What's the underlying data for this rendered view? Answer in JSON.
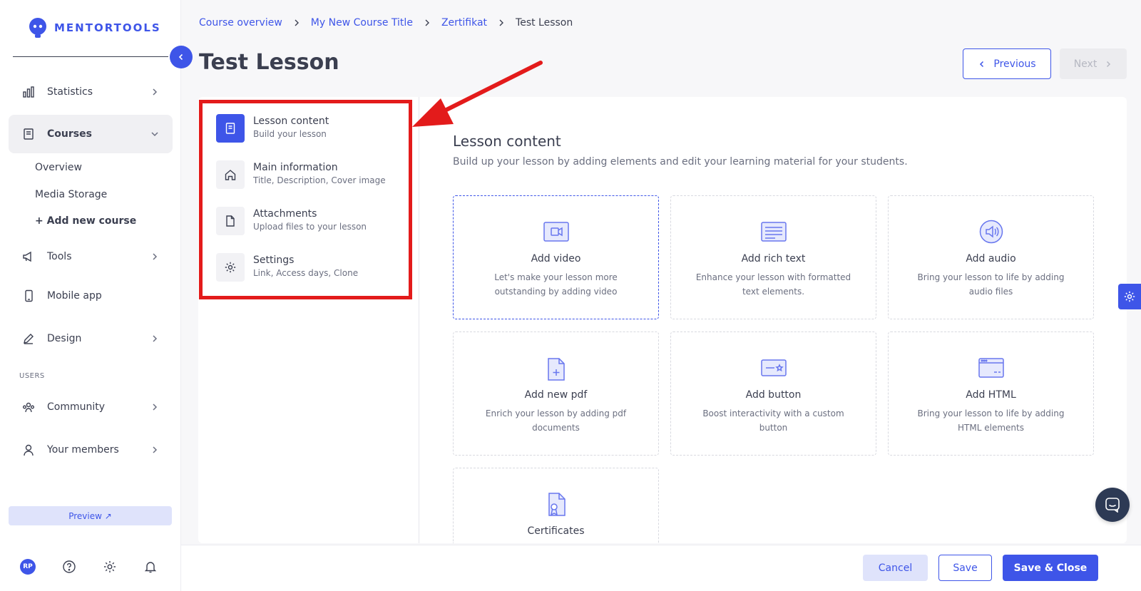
{
  "brand": {
    "name": "MENTORTOOLS"
  },
  "sidebar": {
    "items": [
      {
        "label": "Statistics",
        "icon": "bar-chart-icon"
      },
      {
        "label": "Courses",
        "icon": "book-icon",
        "active": true
      },
      {
        "label": "Tools",
        "icon": "megaphone-icon"
      },
      {
        "label": "Mobile app",
        "icon": "mobile-icon"
      },
      {
        "label": "Design",
        "icon": "pencil-icon"
      },
      {
        "label": "Community",
        "icon": "community-icon"
      },
      {
        "label": "Your members",
        "icon": "user-icon"
      }
    ],
    "sub_items": [
      "Overview",
      "Media Storage",
      "+ Add new course"
    ],
    "section_users": "USERS",
    "preview_label": "Preview ↗",
    "avatar_initials": "RP"
  },
  "breadcrumb": [
    "Course overview",
    "My New Course Title",
    "Zertifikat",
    "Test Lesson"
  ],
  "page": {
    "title": "Test Lesson"
  },
  "pager": {
    "previous": "Previous",
    "next": "Next"
  },
  "tabs": [
    {
      "title": "Lesson content",
      "subtitle": "Build your lesson",
      "icon": "book-icon"
    },
    {
      "title": "Main information",
      "subtitle": "Title, Description, Cover image",
      "icon": "home-icon"
    },
    {
      "title": "Attachments",
      "subtitle": "Upload files to your lesson",
      "icon": "file-icon"
    },
    {
      "title": "Settings",
      "subtitle": "Link, Access days, Clone",
      "icon": "gear-icon"
    }
  ],
  "content": {
    "title": "Lesson content",
    "subtitle": "Build up your lesson by adding elements and edit your learning material for your students.",
    "tiles": [
      {
        "title": "Add video",
        "desc": "Let's make your lesson more outstanding by adding video",
        "icon": "video-icon"
      },
      {
        "title": "Add rich text",
        "desc": "Enhance your lesson with formatted text elements.",
        "icon": "text-icon"
      },
      {
        "title": "Add audio",
        "desc": "Bring your lesson to life by adding audio files",
        "icon": "audio-icon"
      },
      {
        "title": "Add new pdf",
        "desc": "Enrich your lesson by adding pdf documents",
        "icon": "pdf-icon"
      },
      {
        "title": "Add button",
        "desc": "Boost interactivity with a custom button",
        "icon": "button-icon"
      },
      {
        "title": "Add HTML",
        "desc": "Bring your lesson to life by adding HTML elements",
        "icon": "html-icon"
      },
      {
        "title": "Certificates",
        "desc": "",
        "icon": "certificate-icon"
      }
    ]
  },
  "footer": {
    "cancel": "Cancel",
    "save": "Save",
    "save_close": "Save & Close"
  },
  "colors": {
    "accent": "#3e55e8",
    "highlight": "#e31b1b"
  }
}
